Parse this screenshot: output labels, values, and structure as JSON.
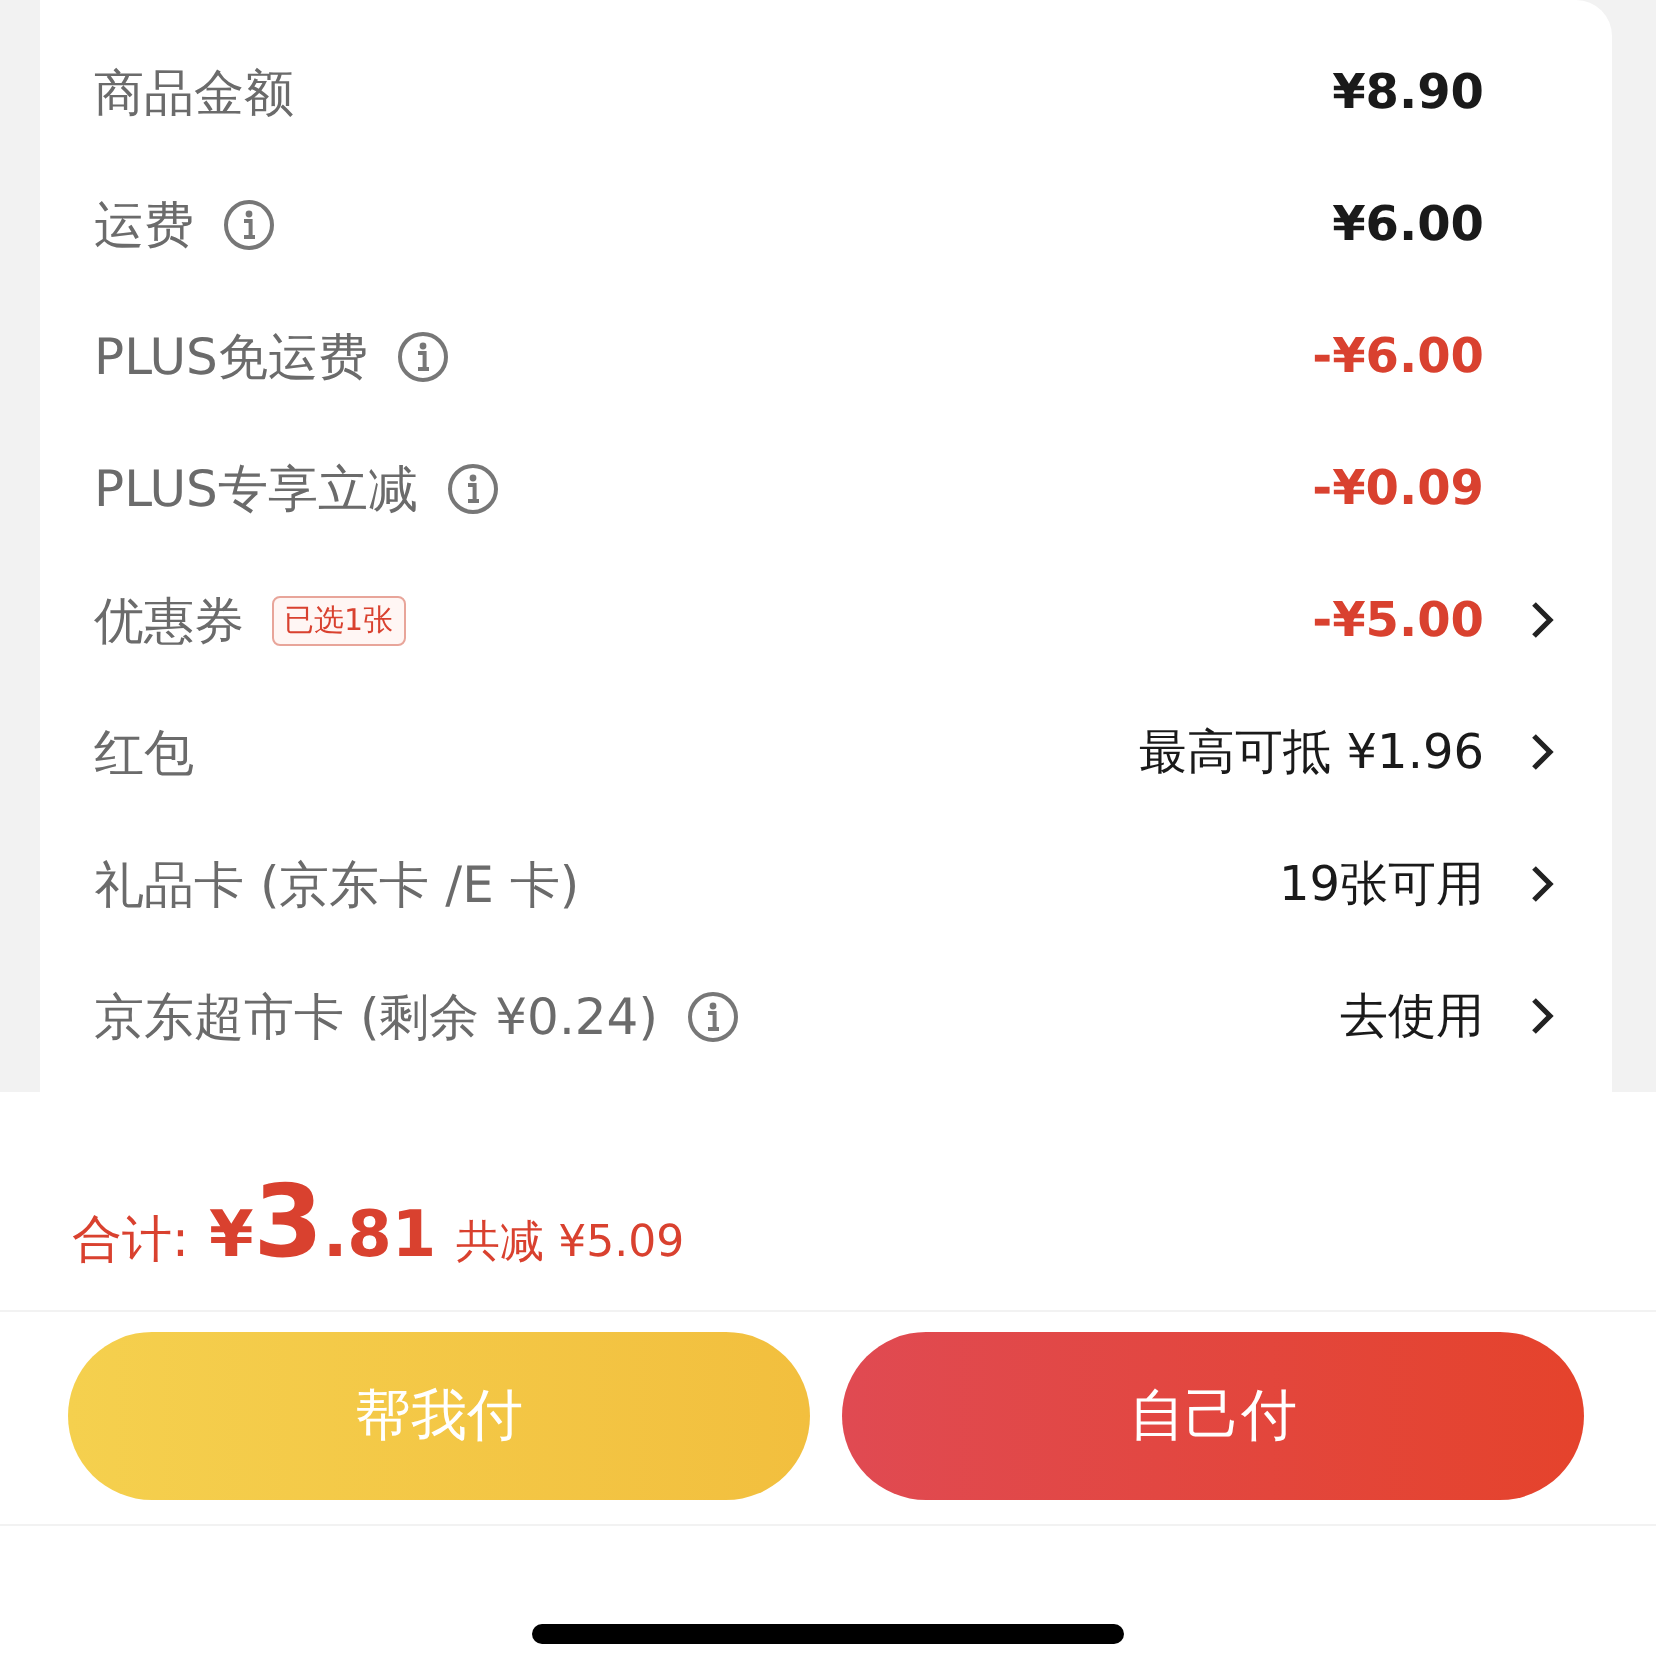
{
  "fees": [
    {
      "label": "商品金额",
      "info": false,
      "value": "¥8.90",
      "kind": "price",
      "chevron": false
    },
    {
      "label": "运费",
      "info": true,
      "value": "¥6.00",
      "kind": "price",
      "chevron": false
    },
    {
      "label": "PLUS免运费",
      "info": true,
      "value": "-¥6.00",
      "kind": "discount",
      "chevron": false
    },
    {
      "label": "PLUS专享立减",
      "info": true,
      "value": "-¥0.09",
      "kind": "discount",
      "chevron": false
    },
    {
      "label": "优惠券",
      "info": false,
      "badge": "已选1张",
      "value": "-¥5.00",
      "kind": "discount",
      "chevron": true
    },
    {
      "label": "红包",
      "info": false,
      "value": "最高可抵 ¥1.96",
      "kind": "text",
      "chevron": true
    },
    {
      "label": "礼品卡 (京东卡 /E 卡)",
      "info": false,
      "value": "19张可用",
      "kind": "text",
      "chevron": true
    },
    {
      "label": "京东超市卡 (剩余 ¥0.24)",
      "info": true,
      "value": "去使用",
      "kind": "text",
      "chevron": true
    }
  ],
  "total": {
    "label": "合计:",
    "currency": "¥",
    "integer": "3",
    "decimal": ".81",
    "saving": "共减 ¥5.09"
  },
  "buttons": [
    {
      "label": "帮我付",
      "kind": "secondary"
    },
    {
      "label": "自己付",
      "kind": "primary"
    }
  ]
}
